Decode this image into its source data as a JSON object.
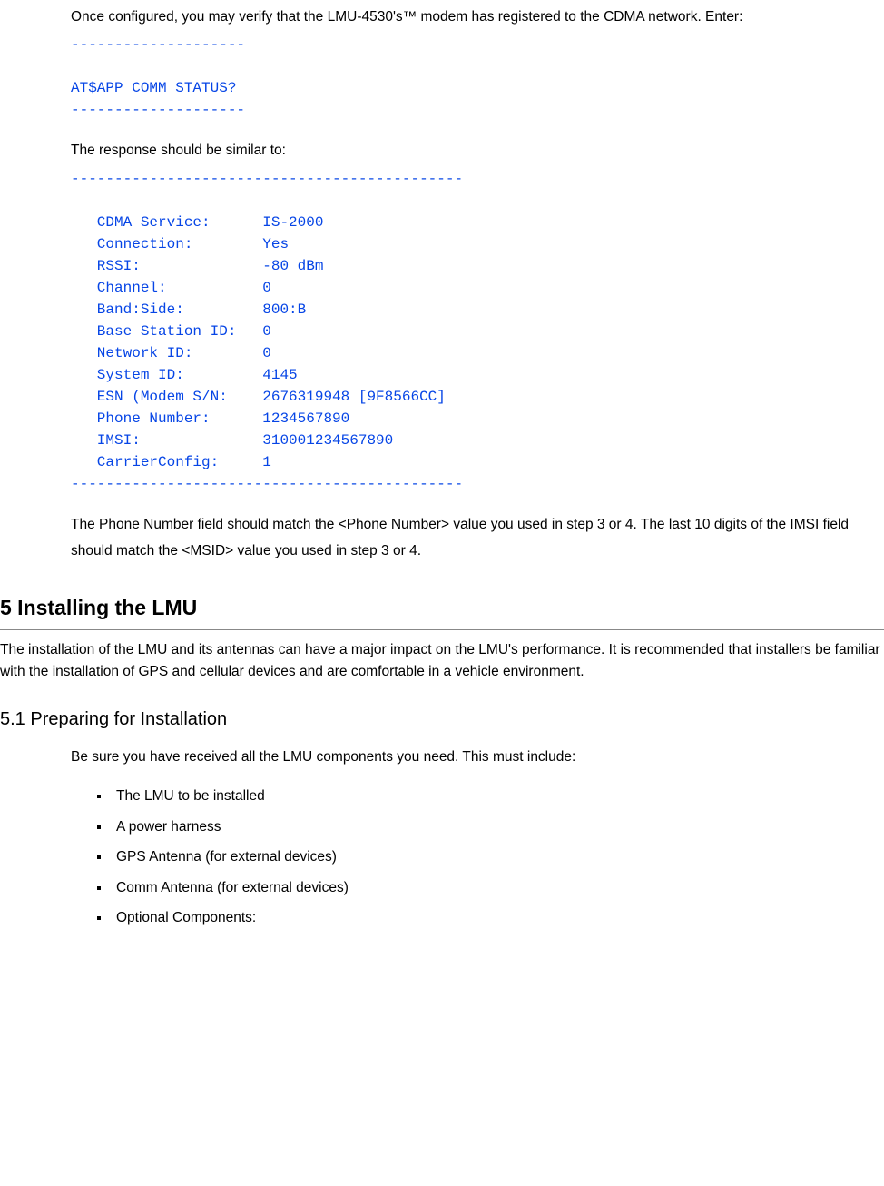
{
  "intro1": "Once configured, you may verify that the LMU-4530's™ modem has registered to the CDMA network. Enter:",
  "code1": "--------------------\n\nAT$APP COMM STATUS?\n--------------------",
  "intro2": "The response should be similar to:",
  "code2": "---------------------------------------------\n\n   CDMA Service:      IS-2000\n   Connection:        Yes\n   RSSI:              -80 dBm\n   Channel:           0\n   Band:Side:         800:B\n   Base Station ID:   0\n   Network ID:        0\n   System ID:         4145\n   ESN (Modem S/N:    2676319948 [9F8566CC]\n   Phone Number:      1234567890\n   IMSI:              310001234567890\n   CarrierConfig:     1\n---------------------------------------------",
  "para2": "The Phone Number field should match the <Phone Number> value you used in step 3 or 4. The last 10 digits of the IMSI field should match the <MSID> value you used in step 3 or 4.",
  "h2": "5 Installing the LMU",
  "para3": "The installation of the LMU and its antennas can have a major impact on the LMU's performance. It is recommended that installers be familiar with the installation of GPS and cellular devices and are comfortable in a vehicle environment.",
  "h3": "5.1 Preparing for Installation",
  "para4": "Be sure you have received all the LMU components you need. This must include:",
  "items": [
    "The LMU to be installed",
    "A power harness",
    "GPS Antenna (for external devices)",
    "Comm Antenna (for external devices)",
    "Optional Components:"
  ]
}
